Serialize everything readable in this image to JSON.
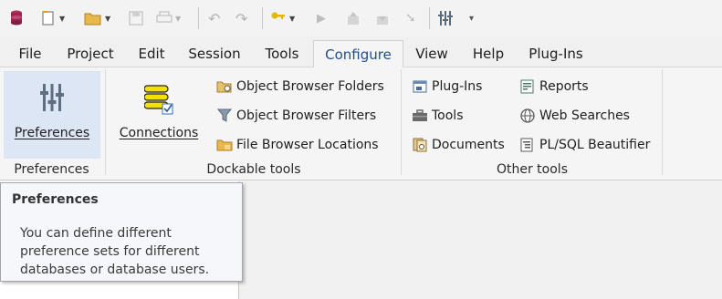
{
  "quick_access": {
    "icons": [
      "database-app-icon",
      "new-icon",
      "open-folder-icon",
      "save-icon",
      "print-icon",
      "undo-icon",
      "redo-icon",
      "key-icon",
      "execute-icon",
      "upload-icon",
      "download-icon",
      "break-icon",
      "customize-icon",
      "dropdown-icon"
    ]
  },
  "menu": {
    "tabs": [
      {
        "label": "File"
      },
      {
        "label": "Project"
      },
      {
        "label": "Edit"
      },
      {
        "label": "Session"
      },
      {
        "label": "Tools"
      },
      {
        "label": "Configure",
        "active": true
      },
      {
        "label": "View"
      },
      {
        "label": "Help"
      },
      {
        "label": "Plug-Ins"
      }
    ]
  },
  "ribbon": {
    "preferences_group": {
      "button_label": "Preferences",
      "group_label": "Preferences"
    },
    "dockable_group": {
      "connections_label": "Connections",
      "object_browser_folders": "Object Browser Folders",
      "object_browser_filters": "Object Browser Filters",
      "file_browser_locations": "File Browser Locations",
      "group_label": "Dockable tools"
    },
    "other_group": {
      "plugins": "Plug-Ins",
      "tools": "Tools",
      "documents": "Documents",
      "reports": "Reports",
      "web_searches": "Web Searches",
      "plsql_beautifier": "PL/SQL Beautifier",
      "group_label": "Other tools"
    }
  },
  "tooltip": {
    "title": "Preferences",
    "lines": [
      "You can define different",
      "preference sets for different",
      "databases or database users."
    ]
  },
  "colors": {
    "accent_tab_text": "#1f4f8a",
    "selected_button_bg": "#dce6f4"
  }
}
